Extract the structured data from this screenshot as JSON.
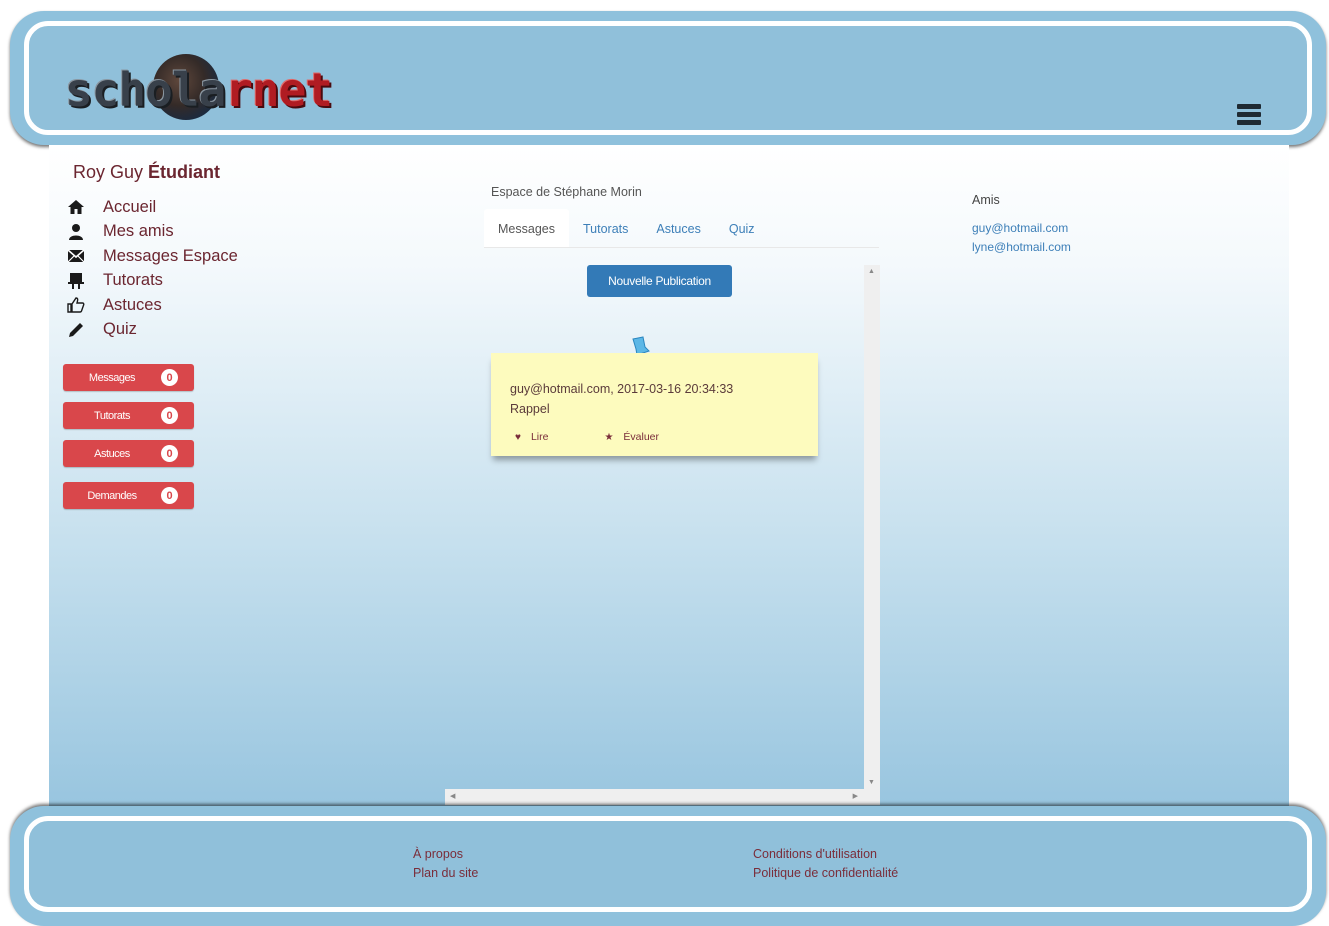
{
  "header": {
    "logo_text_dark": "schol",
    "logo_text_globe": "a",
    "logo_text_red": "rnet",
    "menu_icon": "hamburger-icon"
  },
  "user": {
    "name": "Roy Guy",
    "role": "Étudiant"
  },
  "nav": [
    {
      "label": "Accueil",
      "icon": "home-icon"
    },
    {
      "label": "Mes amis",
      "icon": "user-icon"
    },
    {
      "label": "Messages Espace",
      "icon": "envelope-icon"
    },
    {
      "label": "Tutorats",
      "icon": "presentation-icon"
    },
    {
      "label": "Astuces",
      "icon": "thumbs-up-icon"
    },
    {
      "label": "Quiz",
      "icon": "pencil-icon"
    }
  ],
  "counters": [
    {
      "label": "Messages",
      "count": "0"
    },
    {
      "label": "Tutorats",
      "count": "0"
    },
    {
      "label": "Astuces",
      "count": "0"
    },
    {
      "label": "Demandes",
      "count": "0"
    }
  ],
  "space": {
    "title": "Espace de Stéphane Morin",
    "tabs": [
      "Messages",
      "Tutorats",
      "Astuces",
      "Quiz"
    ],
    "active_tab": "Messages",
    "new_post_label": "Nouvelle Publication"
  },
  "post": {
    "meta": "guy@hotmail.com, 2017-03-16 20:34:33",
    "text": "Rappel",
    "read_label": "Lire",
    "rate_label": "Évaluer"
  },
  "friends": {
    "title": "Amis",
    "items": [
      "guy@hotmail.com",
      "lyne@hotmail.com"
    ]
  },
  "footer": {
    "about": "À propos",
    "sitemap": "Plan du site",
    "terms": "Conditions d'utilisation",
    "privacy": "Politique de confidentialité"
  },
  "colors": {
    "header_blue": "#8fc1dc",
    "accent_red": "#d9474b",
    "primary_blue": "#337ab7",
    "note_yellow": "#fdfbbe",
    "nav_text": "#6b2630"
  }
}
